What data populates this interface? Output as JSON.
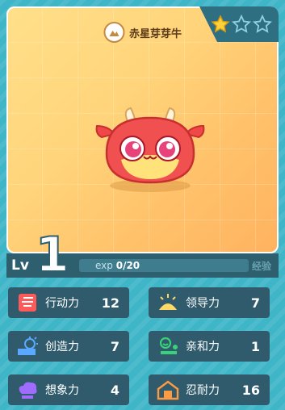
{
  "pet": {
    "name": "赤星芽芽牛",
    "stars_filled": 1,
    "stars_total": 3
  },
  "level": {
    "label": "Lv",
    "value": "1",
    "exp_label": "exp",
    "exp_value": "0/20",
    "exp_suffix": "经验"
  },
  "stats": [
    {
      "name": "行动力",
      "value": "12",
      "icon": "running-icon",
      "color": "#ff5a5a"
    },
    {
      "name": "领导力",
      "value": "7",
      "icon": "sunrise-icon",
      "color": "#ffd966"
    },
    {
      "name": "创造力",
      "value": "7",
      "icon": "lightbulb-icon",
      "color": "#5aa8ff"
    },
    {
      "name": "亲和力",
      "value": "1",
      "icon": "people-icon",
      "color": "#39d17a"
    },
    {
      "name": "想象力",
      "value": "4",
      "icon": "cloud-icon",
      "color": "#a06cff"
    },
    {
      "name": "忍耐力",
      "value": "16",
      "icon": "house-icon",
      "color": "#ff9a40"
    }
  ]
}
